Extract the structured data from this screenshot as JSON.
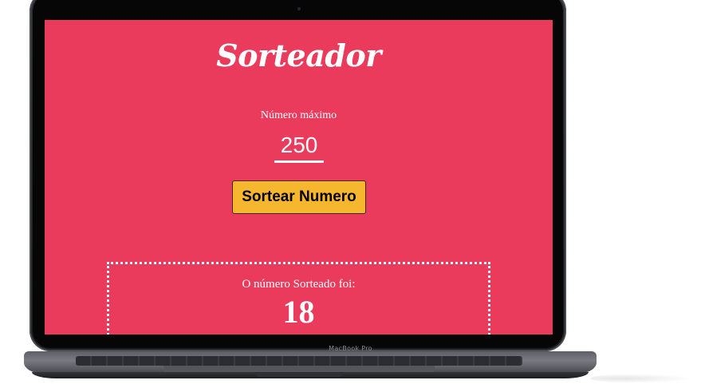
{
  "device": {
    "brand_label": "MacBook Pro"
  },
  "app": {
    "title": "Sorteador",
    "background_color": "#ea3b5c",
    "max_number": {
      "label": "Número máximo",
      "value": "250"
    },
    "draw_button": {
      "label": "Sortear Numero",
      "color": "#f6b62d"
    },
    "result": {
      "label": "O número Sorteado foi:",
      "value": "18"
    }
  }
}
